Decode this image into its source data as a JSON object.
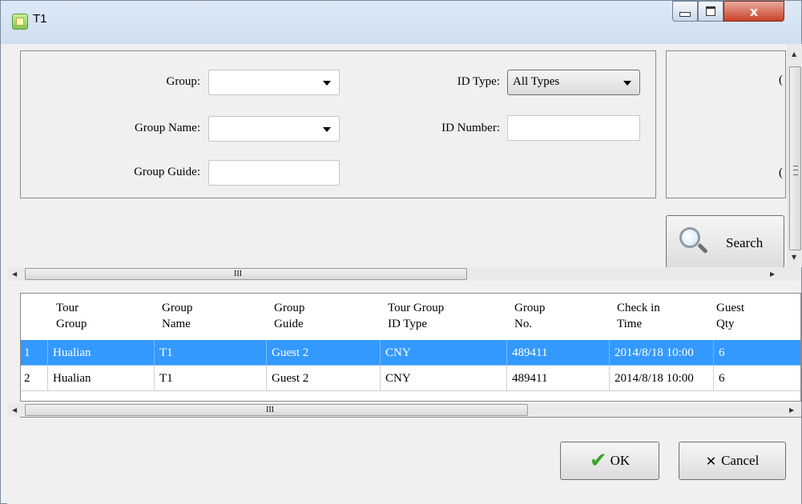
{
  "window": {
    "title": "T1",
    "min_glyph": "",
    "max_glyph": "",
    "close_glyph": "x"
  },
  "filters": {
    "group_label": "Group:",
    "group_name_label": "Group Name:",
    "group_guide_label": "Group Guide:",
    "id_type_label": "ID Type:",
    "id_type_value": "All Types",
    "id_number_label": "ID Number:",
    "right_fragment_1": "(",
    "right_fragment_2": "("
  },
  "search": {
    "label": "Search"
  },
  "scroll": {
    "grip": "III",
    "left": "◀",
    "right": "▶",
    "up": "▲",
    "down": "▼"
  },
  "table": {
    "headers": [
      [
        "Tour",
        "Group"
      ],
      [
        "Group",
        "Name"
      ],
      [
        "Group",
        "Guide"
      ],
      [
        "Tour Group",
        "ID Type"
      ],
      [
        "Group",
        "No."
      ],
      [
        "Check in",
        "Time"
      ],
      [
        "Guest",
        "Qty"
      ]
    ],
    "rows": [
      {
        "num": "1",
        "tour_group": "Hualian",
        "group_name": "T1",
        "group_guide": "Guest 2",
        "id_type": "CNY",
        "group_no": "489411",
        "check_in": "2014/8/18 10:00",
        "qty": "6"
      },
      {
        "num": "2",
        "tour_group": "Hualian",
        "group_name": "T1",
        "group_guide": "Guest 2",
        "id_type": "CNY",
        "group_no": "489411",
        "check_in": "2014/8/18 10:00",
        "qty": "6"
      }
    ]
  },
  "buttons": {
    "ok": "OK",
    "cancel": "Cancel"
  },
  "colors": {
    "selection": "#3399ff",
    "ok_check": "#39a32a"
  }
}
